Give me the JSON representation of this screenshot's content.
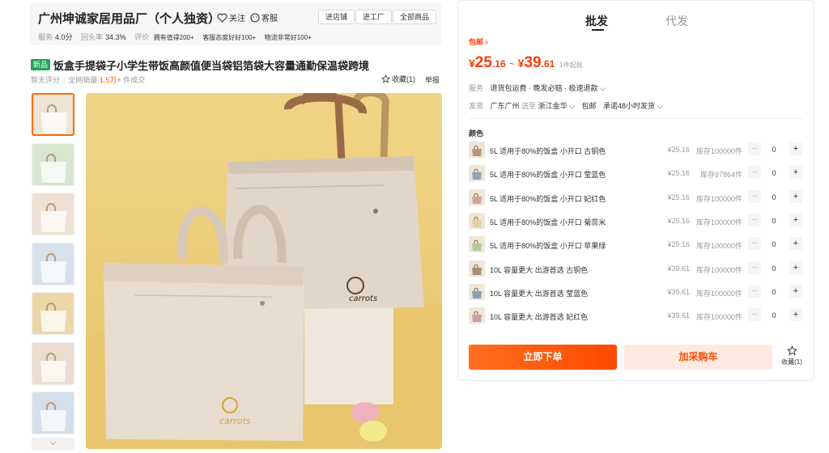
{
  "shop": {
    "name": "广州坤诚家居用品厂（个人独资）",
    "follow": "关注",
    "customer_service": "客服",
    "nav": [
      "进店铺",
      "进工厂",
      "全部商品"
    ],
    "stats": [
      {
        "key": "服务",
        "value": "4.0分"
      },
      {
        "key": "回头率",
        "value": "34.3%"
      },
      {
        "key": "评价",
        "value": ""
      }
    ],
    "tags": [
      "拥有值得200+",
      "客服态度好好100+",
      "物流非常好100+"
    ]
  },
  "product": {
    "badge": "新品",
    "title": "饭盒手提袋子小学生带饭高颜值便当袋铝箔袋大容量通勤保温袋跨境",
    "rating": "暂无评分",
    "sales_label": "全网销量",
    "sales_value": "1.5万+",
    "deals": "件成交",
    "favorite": "收藏(1)",
    "report": "举报"
  },
  "gallery": {
    "thumb_count": 7,
    "active_index": 0,
    "logo_text": "carrots"
  },
  "panel": {
    "tabs": [
      "批发",
      "代发"
    ],
    "free_shipping": "包邮 ›",
    "price": {
      "currency": "¥",
      "low_int": "25",
      "low_dec": ".16",
      "tilde": "~",
      "high_int": "39",
      "high_dec": ".61",
      "min_qty": "1件起批"
    },
    "service": {
      "label": "服务",
      "value": "退货包运费 · 晚发必赔 · 极速退款 ⌵"
    },
    "shipping": {
      "label": "发货",
      "from": "广东广州",
      "to_label": "送至",
      "to": "浙江金华 ⌵",
      "free": "包邮",
      "promise": "承诺48小时发货 ⌵"
    },
    "color_label": "颜色",
    "skus": [
      {
        "name": "5L 适用于80%的饭盒 小开口 古铜色",
        "price": "¥25.16",
        "stock": "库存100000件",
        "qty": "0",
        "swatch": "#b49880"
      },
      {
        "name": "5L 适用于80%的饭盒 小开口 莹蓝色",
        "price": "¥25.16",
        "stock": "库存97864件",
        "qty": "0",
        "swatch": "#8ea6be"
      },
      {
        "name": "5L 适用于80%的饭盒 小开口 妃红色",
        "price": "¥25.16",
        "stock": "库存100000件",
        "qty": "0",
        "swatch": "#d4a4a0"
      },
      {
        "name": "5L 适用于80%的饭盒 小开口 菊蕊米",
        "price": "¥25.16",
        "stock": "库存100000件",
        "qty": "0",
        "swatch": "#e2d0a8"
      },
      {
        "name": "5L 适用于80%的饭盒 小开口 苹果绿",
        "price": "¥25.16",
        "stock": "库存100000件",
        "qty": "0",
        "swatch": "#b6c99e"
      },
      {
        "name": "10L 容量更大 出游首选 古铜色",
        "price": "¥39.61",
        "stock": "库存100000件",
        "qty": "0",
        "swatch": "#a8907a"
      },
      {
        "name": "10L 容量更大 出游首选 莹蓝色",
        "price": "¥39.61",
        "stock": "库存100000件",
        "qty": "0",
        "swatch": "#8aa0b8"
      },
      {
        "name": "10L 容量更大 出游首选 妃红色",
        "price": "¥39.61",
        "stock": "库存100000件",
        "qty": "0",
        "swatch": "#c9a09c"
      }
    ],
    "buy_now": "立即下单",
    "add_cart": "加采购车",
    "favorite": "收藏(1)"
  }
}
